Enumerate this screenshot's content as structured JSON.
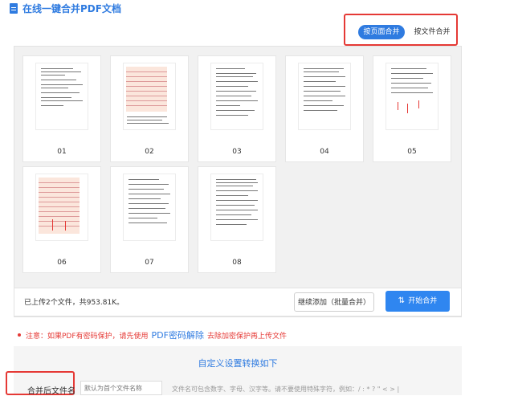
{
  "header": {
    "title": "在线一键合并PDF文档",
    "icon": "document-icon"
  },
  "mode": {
    "by_page": "按页面合并",
    "by_file": "按文件合并",
    "active": "by_page"
  },
  "pages": [
    {
      "label": "01"
    },
    {
      "label": "02"
    },
    {
      "label": "03"
    },
    {
      "label": "04"
    },
    {
      "label": "05"
    },
    {
      "label": "06"
    },
    {
      "label": "07"
    },
    {
      "label": "08"
    }
  ],
  "footer": {
    "upload_info": "已上传2个文件，共953.81K。",
    "continue_button": "继续添加（批量合并）",
    "start_button": "开始合并"
  },
  "notice": {
    "prefix": "注意：如果PDF有密码保护，请先使用",
    "link": "PDF密码解除",
    "suffix": "去除加密保护再上传文件"
  },
  "settings": {
    "title": "自定义设置转换如下",
    "filename_label": "合并后文件名",
    "filename_placeholder": "默认为首个文件名称",
    "filename_hint": "文件名可包含数字、字母、汉字等。请不要使用特殊字符，例如：/ : * ? \" < > |"
  },
  "colors": {
    "accent": "#2f7be0",
    "highlight": "#e53935"
  }
}
